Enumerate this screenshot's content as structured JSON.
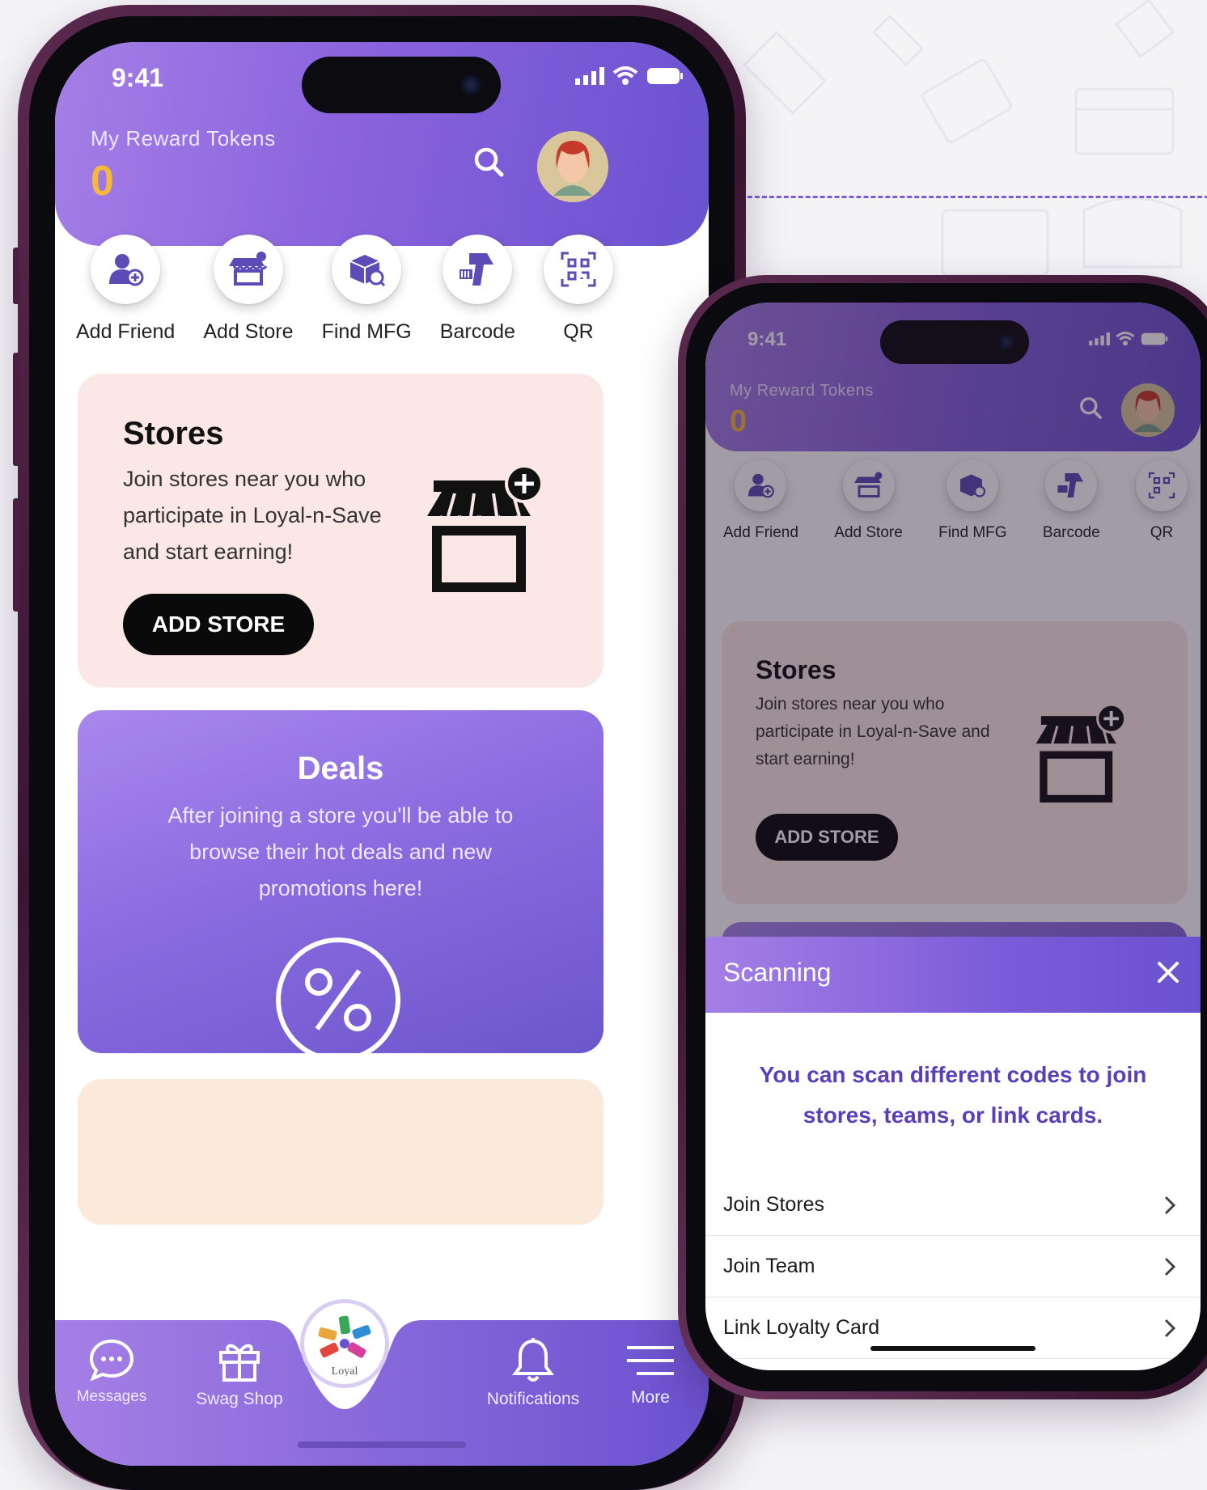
{
  "status": {
    "time": "9:41"
  },
  "header": {
    "label": "My Reward Tokens",
    "tokens": "0"
  },
  "quick_actions": [
    {
      "label": "Add Friend",
      "icon": "add-friend-icon"
    },
    {
      "label": "Add Store",
      "icon": "add-store-icon"
    },
    {
      "label": "Find MFG",
      "icon": "find-mfg-icon"
    },
    {
      "label": "Barcode",
      "icon": "barcode-scanner-icon"
    },
    {
      "label": "QR",
      "icon": "qr-code-icon"
    }
  ],
  "stores_card": {
    "title": "Stores",
    "description": "Join stores near you who participate in Loyal-n-Save and start earning!",
    "button": "ADD STORE"
  },
  "deals_card": {
    "title": "Deals",
    "description": "After joining a store you'll be able to browse their hot deals and new promotions here!"
  },
  "bottom_nav": {
    "items": [
      {
        "label": "Messages",
        "icon": "chat-bubble-icon"
      },
      {
        "label": "Swag Shop",
        "icon": "gift-icon"
      },
      {
        "label": "Notifications",
        "icon": "bell-icon"
      },
      {
        "label": "More",
        "icon": "menu-lines-icon"
      }
    ],
    "center_icon": "app-logo-icon"
  },
  "scanning_sheet": {
    "title": "Scanning",
    "message": "You can scan different codes to join stores, teams, or link cards.",
    "options": [
      {
        "label": "Join Stores"
      },
      {
        "label": "Join Team"
      },
      {
        "label": "Link Loyalty Card"
      }
    ]
  },
  "colors": {
    "accent_purple": "#8a63dd",
    "token_gold": "#f6b73c",
    "stores_bg": "#fbe8e6",
    "sheet_text": "#5a3fb8"
  }
}
